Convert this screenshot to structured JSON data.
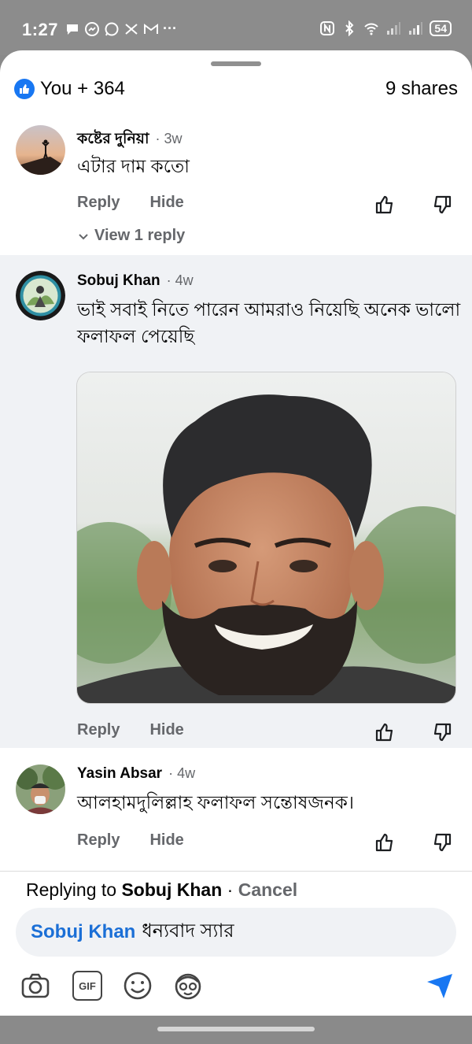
{
  "status": {
    "time": "1:27",
    "battery": "54",
    "left_icons": [
      "chat-bubble-icon",
      "messenger-icon",
      "whatsapp-icon",
      "scissors-icon",
      "gmail-icon",
      "more-dots-icon"
    ],
    "right_icons": [
      "nfc-icon",
      "bluetooth-icon",
      "wifi-icon",
      "signal-icon",
      "signal-icon",
      "battery-icon"
    ],
    "more_dots": "···"
  },
  "summary": {
    "likes": "You + 364",
    "shares": "9 shares"
  },
  "comments": [
    {
      "name": "কষ্টের দুনিয়া",
      "time": "3w",
      "text": "এটার দাম কতো",
      "reply_label": "Reply",
      "hide_label": "Hide",
      "view_replies": "View 1 reply"
    },
    {
      "name": "Sobuj Khan",
      "time": "4w",
      "text": "ভাই সবাই নিতে পারেন আমরাও নিয়েছি অনেক ভালো ফলাফল পেয়েছি",
      "reply_label": "Reply",
      "hide_label": "Hide",
      "has_photo": true
    },
    {
      "name": "Yasin Absar",
      "time": "4w",
      "text": "আলহামদুলিল্লাহ ফলাফল সন্তোষজনক।",
      "reply_label": "Reply",
      "hide_label": "Hide"
    }
  ],
  "composer": {
    "replying_prefix": "Replying to",
    "replying_name": "Sobuj Khan",
    "separator": "·",
    "cancel": "Cancel",
    "mention": "Sobuj Khan",
    "draft_text": "ধন্যবাদ স্যার",
    "tools": [
      "camera-icon",
      "gif-icon",
      "emoji-icon",
      "avatar-sticker-icon",
      "send-icon"
    ],
    "gif_label": "GIF"
  },
  "colors": {
    "accent": "#1877f2",
    "muted_text": "#65676b",
    "highlight_bg": "#f0f2f5"
  }
}
